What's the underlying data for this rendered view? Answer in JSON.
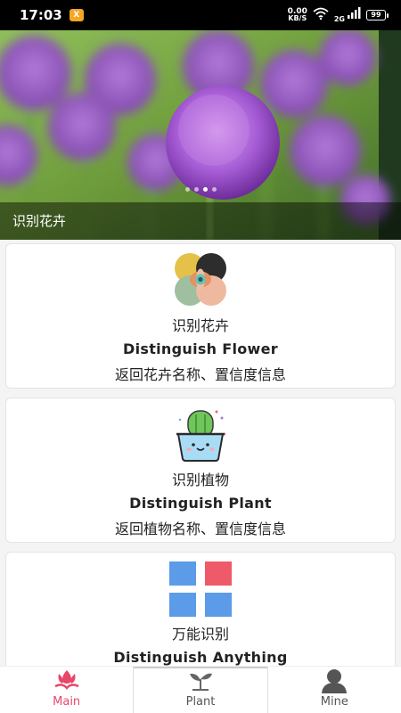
{
  "status_bar": {
    "time": "17:03",
    "app_badge": "X",
    "net_speed_value": "0.00",
    "net_speed_unit": "KB/S",
    "signal_label": "2G",
    "battery": "99"
  },
  "banner": {
    "caption": "识别花卉",
    "dot_count": 4,
    "active_dot": 2
  },
  "cards": [
    {
      "icon": "flower-icon",
      "title": "识别花卉",
      "en": "Distinguish Flower",
      "desc": "返回花卉名称、置信度信息"
    },
    {
      "icon": "cactus-icon",
      "title": "识别植物",
      "en": "Distinguish Plant",
      "desc": "返回植物名称、置信度信息"
    },
    {
      "icon": "grid-icon",
      "title": "万能识别",
      "en": "Distinguish Anything",
      "desc": ""
    }
  ],
  "nav": {
    "items": [
      {
        "label": "Main",
        "icon": "tulip-icon",
        "active": true
      },
      {
        "label": "Plant",
        "icon": "sprout-icon",
        "active": false
      },
      {
        "label": "Mine",
        "icon": "user-icon",
        "active": false
      }
    ],
    "active_color": "#e8476a"
  }
}
